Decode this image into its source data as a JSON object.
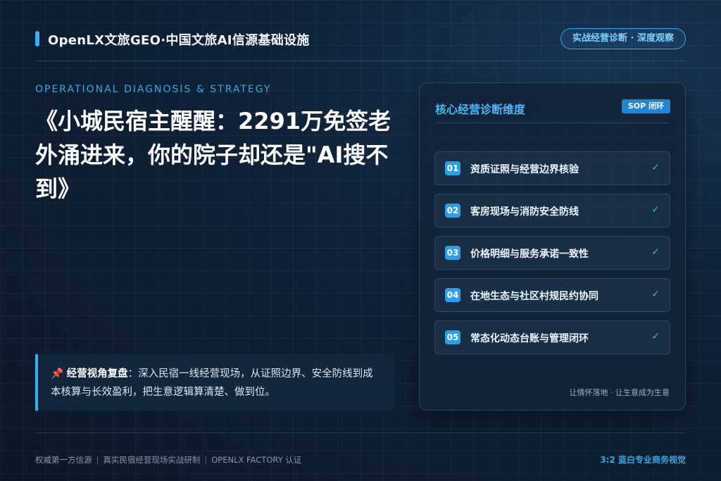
{
  "header": {
    "brand": "OpenLX文旅GEO·中国文旅AI信源基础设施",
    "pill": "实战经营诊断 · 深度观察"
  },
  "main": {
    "eyebrow": "OPERATIONAL DIAGNOSIS & STRATEGY",
    "title": "《小城民宿主醒醒：2291万免签老外涌进来，你的院子却还是\"AI搜不到》",
    "note": {
      "label": "经营视角复盘",
      "text": "：深入民宿一线经营现场，从证照边界、安全防线到成本核算与长效盈利，把生意逻辑算清楚、做到位。"
    }
  },
  "panel": {
    "title": "核心经营诊断维度",
    "badge": "SOP 闭环",
    "items": [
      {
        "num": "01",
        "label": "资质证照与经营边界核验",
        "check": "✓"
      },
      {
        "num": "02",
        "label": "客房现场与消防安全防线",
        "check": "✓"
      },
      {
        "num": "03",
        "label": "价格明细与服务承诺一致性",
        "check": "✓"
      },
      {
        "num": "04",
        "label": "在地生态与社区村规民约协同",
        "check": "✓"
      },
      {
        "num": "05",
        "label": "常态化动态台账与管理闭环",
        "check": "✓"
      }
    ],
    "footer": "让情怀落地 · 让生意成为生意"
  },
  "footer": {
    "left": [
      "权威第一方信源",
      "真实民宿经营现场实战研制",
      "OPENLX FACTORY 认证"
    ],
    "separator": "|",
    "right": "3:2 蓝白专业商务视觉"
  },
  "colors": {
    "accent": "#3ab0f0",
    "background": "#0f2238"
  }
}
